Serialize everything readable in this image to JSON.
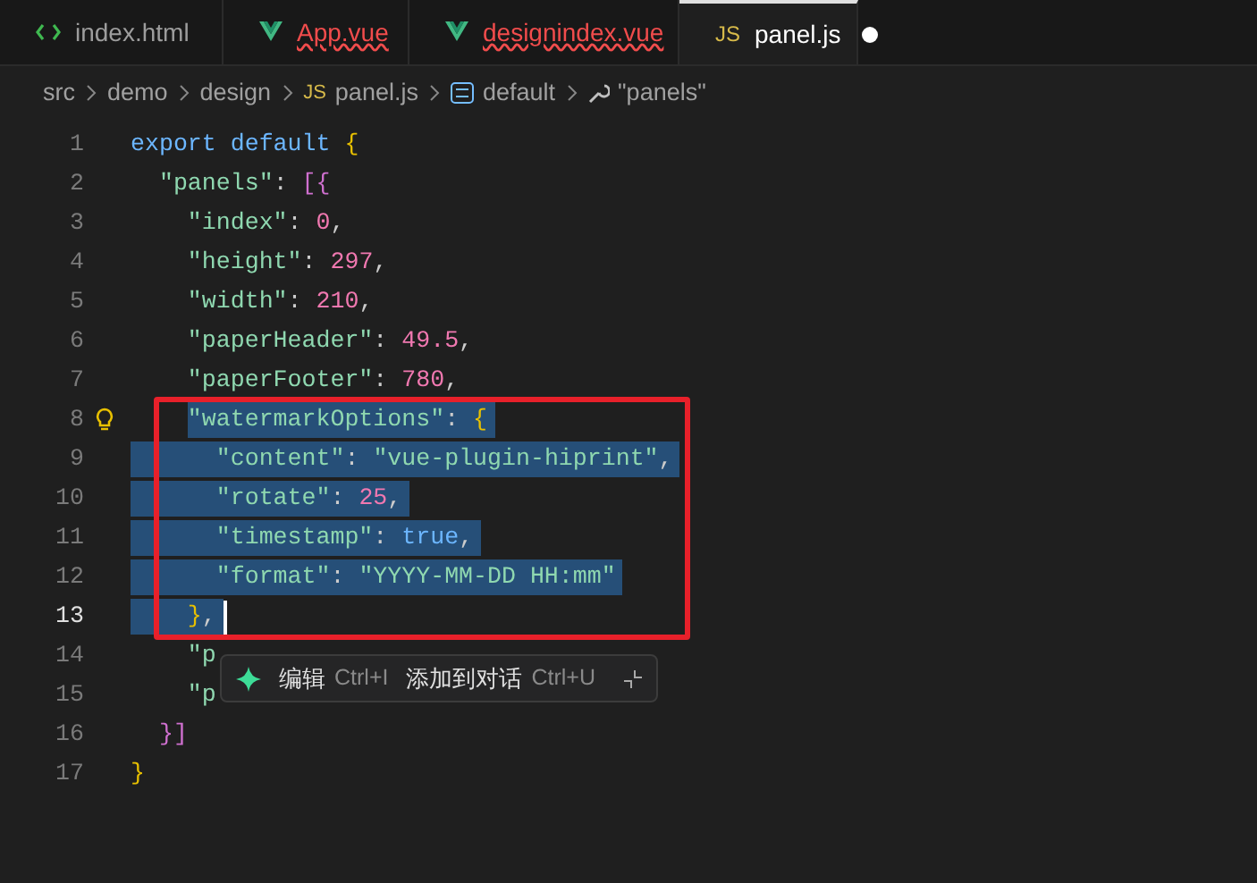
{
  "tabs": [
    {
      "label": "index.html",
      "kind": "html",
      "selected": false,
      "error": false,
      "modified": false
    },
    {
      "label": "App.vue",
      "kind": "vue",
      "selected": false,
      "error": true,
      "modified": false
    },
    {
      "label": "designindex.vue",
      "kind": "vue",
      "selected": false,
      "error": true,
      "modified": false
    },
    {
      "label": "panel.js",
      "kind": "js",
      "badge": "JS",
      "selected": true,
      "error": false,
      "modified": true
    }
  ],
  "breadcrumb": [
    {
      "label": "src",
      "kind": "folder"
    },
    {
      "label": "demo",
      "kind": "folder"
    },
    {
      "label": "design",
      "kind": "folder"
    },
    {
      "label": "panel.js",
      "kind": "file",
      "badge": "JS"
    },
    {
      "label": "default",
      "kind": "module"
    },
    {
      "label": "\"panels\"",
      "kind": "property"
    }
  ],
  "lines": [
    {
      "number": "1",
      "selected": false,
      "current": false,
      "tokens": [
        {
          "kind": "keyword",
          "text": "export default "
        },
        {
          "kind": "brace",
          "text": "{"
        }
      ],
      "children": [
        {
          "number": "2",
          "selected": false,
          "current": false,
          "tokens": [
            {
              "kind": "key",
              "text": "\"panels\""
            },
            {
              "kind": "punct",
              "text": ": "
            },
            {
              "kind": "brace2",
              "text": "[{"
            }
          ],
          "children": [
            {
              "number": "3",
              "selected": false,
              "current": false,
              "tokens": [
                {
                  "kind": "key",
                  "text": "\"index\""
                },
                {
                  "kind": "punct",
                  "text": ": "
                },
                {
                  "kind": "number",
                  "text": "0"
                },
                {
                  "kind": "punct",
                  "text": ","
                }
              ]
            },
            {
              "number": "4",
              "selected": false,
              "current": false,
              "tokens": [
                {
                  "kind": "key",
                  "text": "\"height\""
                },
                {
                  "kind": "punct",
                  "text": ": "
                },
                {
                  "kind": "number",
                  "text": "297"
                },
                {
                  "kind": "punct",
                  "text": ","
                }
              ]
            },
            {
              "number": "5",
              "selected": false,
              "current": false,
              "tokens": [
                {
                  "kind": "key",
                  "text": "\"width\""
                },
                {
                  "kind": "punct",
                  "text": ": "
                },
                {
                  "kind": "number",
                  "text": "210"
                },
                {
                  "kind": "punct",
                  "text": ","
                }
              ]
            },
            {
              "number": "6",
              "selected": false,
              "current": false,
              "tokens": [
                {
                  "kind": "key",
                  "text": "\"paperHeader\""
                },
                {
                  "kind": "punct",
                  "text": ": "
                },
                {
                  "kind": "number",
                  "text": "49.5"
                },
                {
                  "kind": "punct",
                  "text": ","
                }
              ]
            },
            {
              "number": "7",
              "selected": false,
              "current": false,
              "tokens": [
                {
                  "kind": "key",
                  "text": "\"paperFooter\""
                },
                {
                  "kind": "punct",
                  "text": ": "
                },
                {
                  "kind": "number",
                  "text": "780"
                },
                {
                  "kind": "punct",
                  "text": ","
                }
              ]
            },
            {
              "number": "8",
              "selected": true,
              "indent_selected": false,
              "current": false,
              "lightbulb": true,
              "tokens": [
                {
                  "kind": "key",
                  "text": "\"watermarkOptions\""
                },
                {
                  "kind": "punct",
                  "text": ": "
                },
                {
                  "kind": "brace3",
                  "text": "{"
                }
              ],
              "children": [
                {
                  "number": "9",
                  "selected": true,
                  "indent_selected": true,
                  "current": false,
                  "tokens": [
                    {
                      "kind": "key",
                      "text": "\"content\""
                    },
                    {
                      "kind": "punct",
                      "text": ": "
                    },
                    {
                      "kind": "string",
                      "text": "\"vue-plugin-hiprint\""
                    },
                    {
                      "kind": "punct",
                      "text": ","
                    }
                  ]
                },
                {
                  "number": "10",
                  "selected": true,
                  "indent_selected": true,
                  "current": false,
                  "tokens": [
                    {
                      "kind": "key",
                      "text": "\"rotate\""
                    },
                    {
                      "kind": "punct",
                      "text": ": "
                    },
                    {
                      "kind": "number",
                      "text": "25"
                    },
                    {
                      "kind": "punct",
                      "text": ","
                    }
                  ]
                },
                {
                  "number": "11",
                  "selected": true,
                  "indent_selected": true,
                  "current": false,
                  "tokens": [
                    {
                      "kind": "key",
                      "text": "\"timestamp\""
                    },
                    {
                      "kind": "punct",
                      "text": ": "
                    },
                    {
                      "kind": "bool",
                      "text": "true"
                    },
                    {
                      "kind": "punct",
                      "text": ","
                    }
                  ]
                },
                {
                  "number": "12",
                  "selected": true,
                  "indent_selected": true,
                  "current": false,
                  "tokens": [
                    {
                      "kind": "key",
                      "text": "\"format\""
                    },
                    {
                      "kind": "punct",
                      "text": ": "
                    },
                    {
                      "kind": "string",
                      "text": "\"YYYY-MM-DD HH:mm\""
                    }
                  ]
                }
              ]
            },
            {
              "number": "13",
              "selected": true,
              "indent_selected": true,
              "current": true,
              "tokens": [
                {
                  "kind": "brace3",
                  "text": "}"
                },
                {
                  "kind": "punct",
                  "text": ","
                }
              ]
            },
            {
              "number": "14",
              "selected": false,
              "current": false,
              "tokens": [
                {
                  "kind": "key",
                  "text": "\"p"
                }
              ]
            },
            {
              "number": "15",
              "selected": false,
              "current": false,
              "tokens": [
                {
                  "kind": "key",
                  "text": "\"p"
                }
              ]
            }
          ]
        },
        {
          "number": "16",
          "selected": false,
          "current": false,
          "tokens": [
            {
              "kind": "brace2",
              "text": "}]"
            }
          ]
        }
      ]
    },
    {
      "number": "17",
      "selected": false,
      "current": false,
      "tokens": [
        {
          "kind": "brace",
          "text": "}"
        }
      ]
    }
  ],
  "inline_chat": {
    "actions": [
      {
        "label": "编辑",
        "shortcut": "Ctrl+I"
      },
      {
        "label": "添加到对话",
        "shortcut": "Ctrl+U"
      }
    ]
  }
}
